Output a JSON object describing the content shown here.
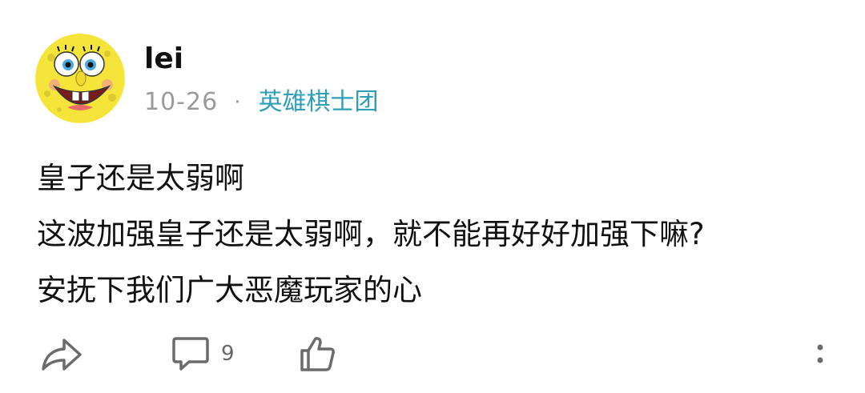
{
  "post": {
    "username": "lei",
    "date": "10-26",
    "separator": "·",
    "group": "英雄棋士团",
    "content_lines": [
      "皇子还是太弱啊",
      "这波加强皇子还是太弱啊，就不能再好好加强下嘛?",
      "安抚下我们广大恶魔玩家的心"
    ]
  },
  "actions": {
    "share_icon": "share-arrow-icon",
    "comment_icon": "comment-bubble-icon",
    "comment_count": "9",
    "like_icon": "thumbs-up-icon",
    "more_icon": "more-vertical-icon"
  },
  "colors": {
    "group_link": "#2f9fb8",
    "meta_gray": "#9a9a9a",
    "icon_gray": "#666666",
    "avatar_yellow": "#f5e53a"
  }
}
